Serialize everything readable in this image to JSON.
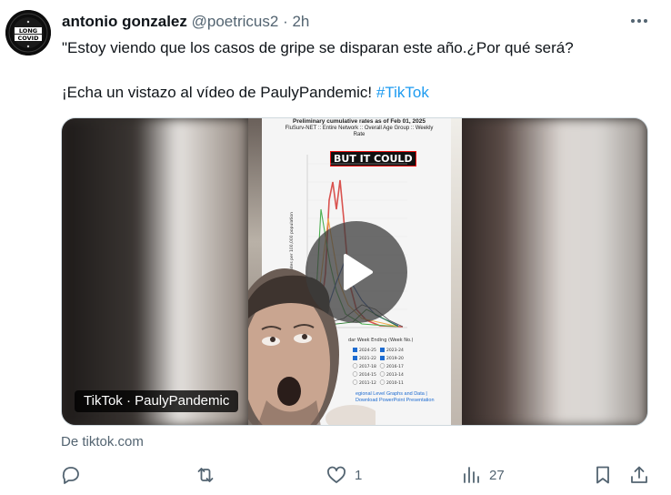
{
  "tweet": {
    "author_name": "antonio gonzalez",
    "handle": "@poetricus2",
    "separator": "·",
    "time": "2h",
    "text_line1": "\"Estoy viendo que los casos de gripe se disparan este año.¿Por qué será?",
    "text_line2_prefix": "¡Echa un vistazo al vídeo de PaulyPandemic! ",
    "hashtag": "#TikTok"
  },
  "avatar": {
    "line1": "LONG",
    "line2": "COVID"
  },
  "media": {
    "badge": "TikTok · PaulyPandemic",
    "source": "De tiktok.com",
    "video_chart_title": "Preliminary cumulative rates as of Feb 01, 2025",
    "video_chart_subtitle": "FluSurv-NET :: Entire Network :: Overall Age Group :: Weekly",
    "video_chart_subtitle2": "Rate",
    "video_caption": "BUT IT COULD",
    "video_ylabel": "Rates per 100,000 population",
    "video_xlabel": "dar Week Ending (Week No.)",
    "video_footer1": "egional Level Graphs and Data |",
    "video_footer2": "Download PowerPoint Presentation",
    "video_legend": [
      "2024-25",
      "2023-24",
      "2021-22",
      "2019-20",
      "2017-18",
      "2016-17",
      "2014-15",
      "2013-14",
      "2011-12",
      "2010-11"
    ]
  },
  "actions": {
    "reply_count": "",
    "retweet_count": "",
    "like_count": "1",
    "views_count": "27"
  },
  "colors": {
    "text_primary": "#0f1419",
    "text_secondary": "#536471",
    "link": "#1d9bf0"
  }
}
